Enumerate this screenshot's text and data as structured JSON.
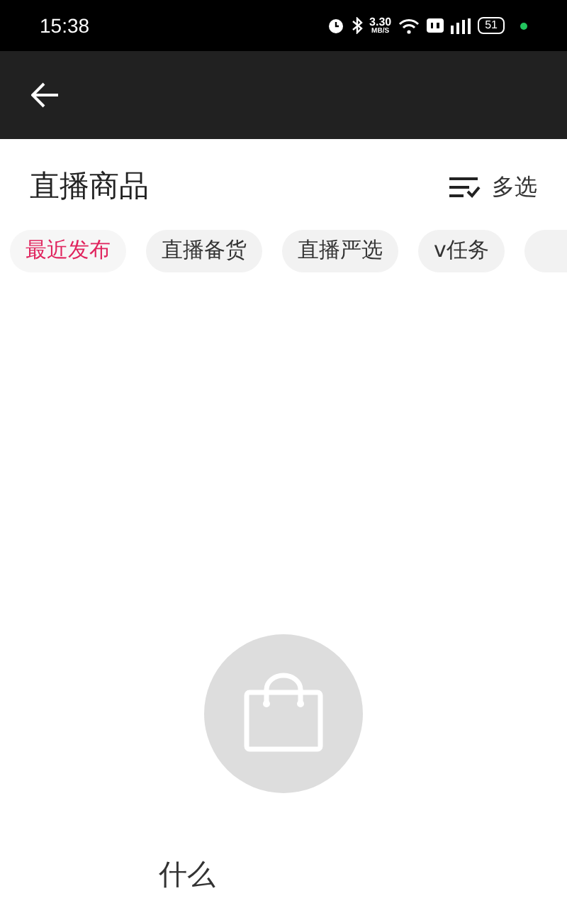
{
  "status_bar": {
    "time": "15:38",
    "speed": "3.30",
    "speed_unit": "MB/S",
    "battery": "51"
  },
  "header": {
    "title": "直播商品",
    "multi_select": "多选"
  },
  "tabs": [
    {
      "label": "最近发布",
      "selected": true
    },
    {
      "label": "直播备货",
      "selected": false
    },
    {
      "label": "直播严选",
      "selected": false
    },
    {
      "label": "v任务",
      "selected": false
    }
  ],
  "empty_state": {
    "message": "什么"
  }
}
